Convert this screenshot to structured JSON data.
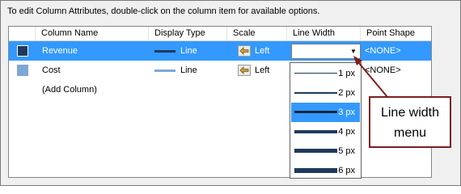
{
  "instructions": "To edit Column Attributes, double-click on the column item for available options.",
  "columns": [
    "Column Name",
    "Display Type",
    "Scale",
    "Line Width",
    "Point Shape"
  ],
  "rows": [
    {
      "name": "Revenue",
      "display_type": "Line",
      "scale": "Left",
      "point_shape": "<NONE>",
      "swatch_color": "#1f3a5c",
      "line_color": "#1f3a5c",
      "selected": true
    },
    {
      "name": "Cost",
      "display_type": "Line",
      "scale": "Left",
      "point_shape": "<NONE>",
      "swatch_color": "#7ea6d6",
      "line_color": "#7ea6d6",
      "selected": false
    },
    {
      "name": "(Add Column)"
    }
  ],
  "line_width_menu": {
    "options": [
      "1 px",
      "2 px",
      "3 px",
      "4 px",
      "5 px",
      "6 px"
    ],
    "selected": "3 px"
  },
  "callout": {
    "line1": "Line width",
    "line2": "menu"
  },
  "colors": {
    "selection": "#3399ff",
    "callout_border": "#7b1f1f",
    "line_dark": "#1f3a5c"
  }
}
